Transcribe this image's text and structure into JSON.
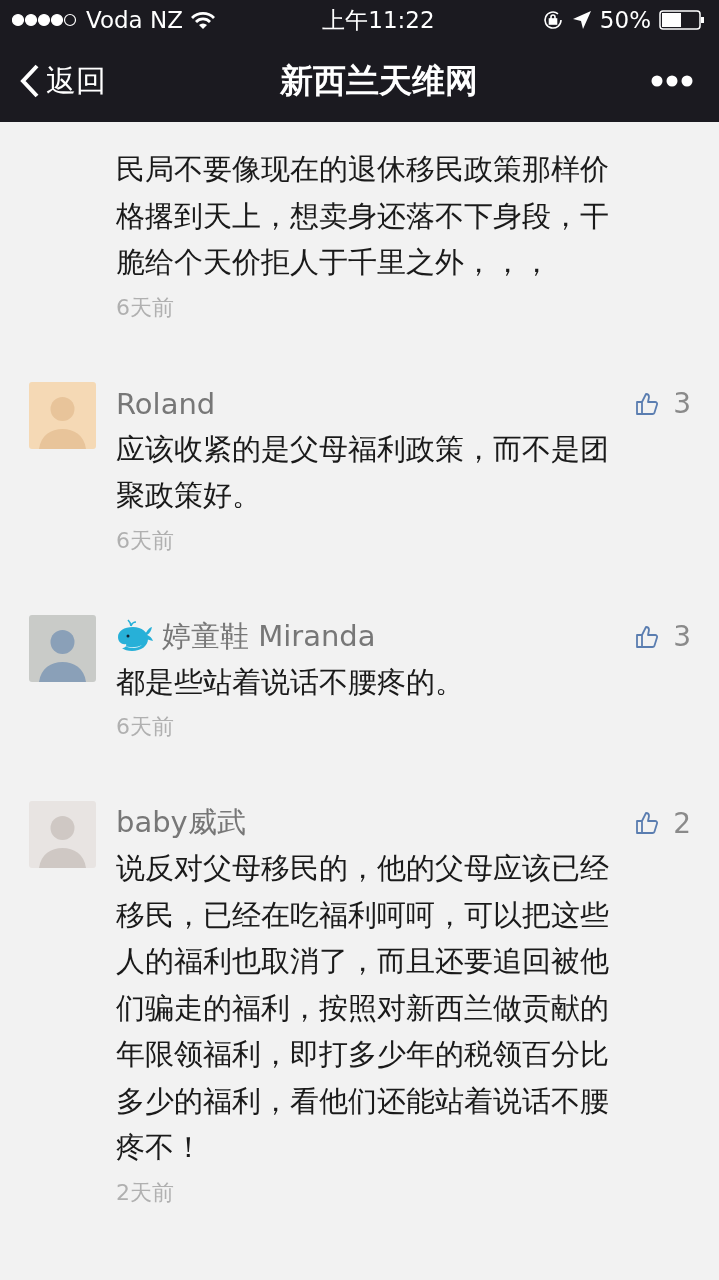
{
  "status_bar": {
    "carrier": "Voda NZ",
    "time": "上午11:22",
    "battery": "50%"
  },
  "nav": {
    "back": "返回",
    "title": "新西兰天维网"
  },
  "partial_comment": {
    "lines": [
      "民局不要像现在的退休移民政策那样价",
      "格撂到天上，想卖身还落不下身段，干",
      "脆给个天价拒人于千里之外，，，"
    ],
    "time": "6天前"
  },
  "comments": [
    {
      "name": "Roland",
      "emoji": false,
      "likes": "3",
      "lines": [
        "应该收紧的是父母福利政策，而不是团",
        "聚政策好。"
      ],
      "time": "6天前"
    },
    {
      "name": "婷童鞋 Miranda",
      "emoji": true,
      "likes": "3",
      "lines": [
        "都是些站着说话不腰疼的。"
      ],
      "time": "6天前"
    },
    {
      "name": "baby威武",
      "emoji": false,
      "likes": "2",
      "lines": [
        "说反对父母移民的，他的父母应该已经",
        "移民，已经在吃福利呵呵，可以把这些",
        "人的福利也取消了，而且还要追回被他",
        "们骗走的福利，按照对新西兰做贡献的",
        "年限领福利，即打多少年的税领百分比",
        "多少的福利，看他们还能站着说话不腰",
        "疼不！"
      ],
      "time": "2天前"
    }
  ]
}
